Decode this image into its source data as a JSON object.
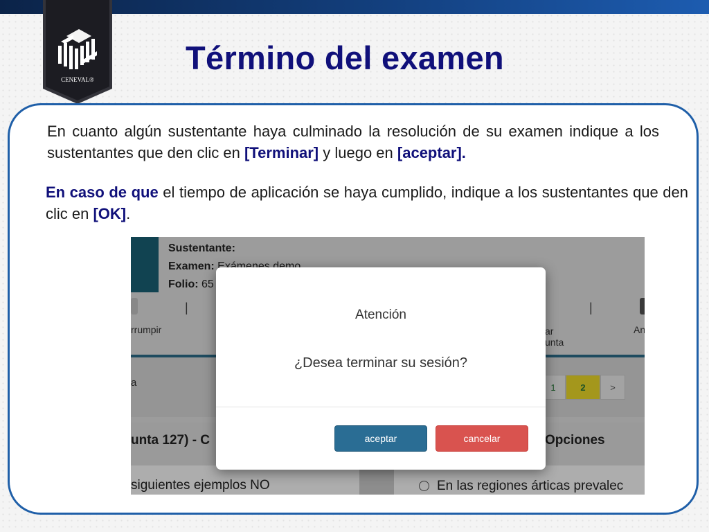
{
  "slide": {
    "title": "Término del examen",
    "logo_text": "CENEVAL®",
    "paragraph1_part1": "En cuanto algún sustentante haya culminado la resolución de su examen indique a los sustentantes que den clic en ",
    "paragraph1_bold1": "[Terminar]",
    "paragraph1_part2": " y luego en ",
    "paragraph1_bold2": "[aceptar].",
    "paragraph2_bold1": "En caso de que",
    "paragraph2_part1": " el tiempo de aplicación se haya cumplido, indique a los sustentantes  que den clic en ",
    "paragraph2_bold2": "[OK]",
    "paragraph2_part2": "."
  },
  "colors": {
    "title": "#10107a",
    "panel_border": "#1f5fa8",
    "accept_button": "#2a6d94",
    "cancel_button": "#d9534f",
    "active_page": "#f2df2a"
  },
  "screenshot": {
    "info": {
      "sustentante_label": "Sustentante:",
      "examen_label": "Examen:",
      "examen_value": " Exámenes demo",
      "folio_label": "Folio:",
      "folio_value": " 65"
    },
    "toolbar": {
      "left_fragment": "rrumpir",
      "separator": "|",
      "middle_fragment_line1": "ar",
      "middle_fragment_line2": "unta",
      "right_fragment": "An"
    },
    "nav_fragment": "a",
    "pager": [
      "1",
      "2",
      ">"
    ],
    "question_header": "unta 127) - C",
    "options_header": "Opciones",
    "question_text": "siguientes ejemplos NO",
    "option_text": "En las regiones árticas prevalec"
  },
  "modal": {
    "title": "Atención",
    "message": "¿Desea terminar su sesión?",
    "accept_label": "aceptar",
    "cancel_label": "cancelar"
  }
}
